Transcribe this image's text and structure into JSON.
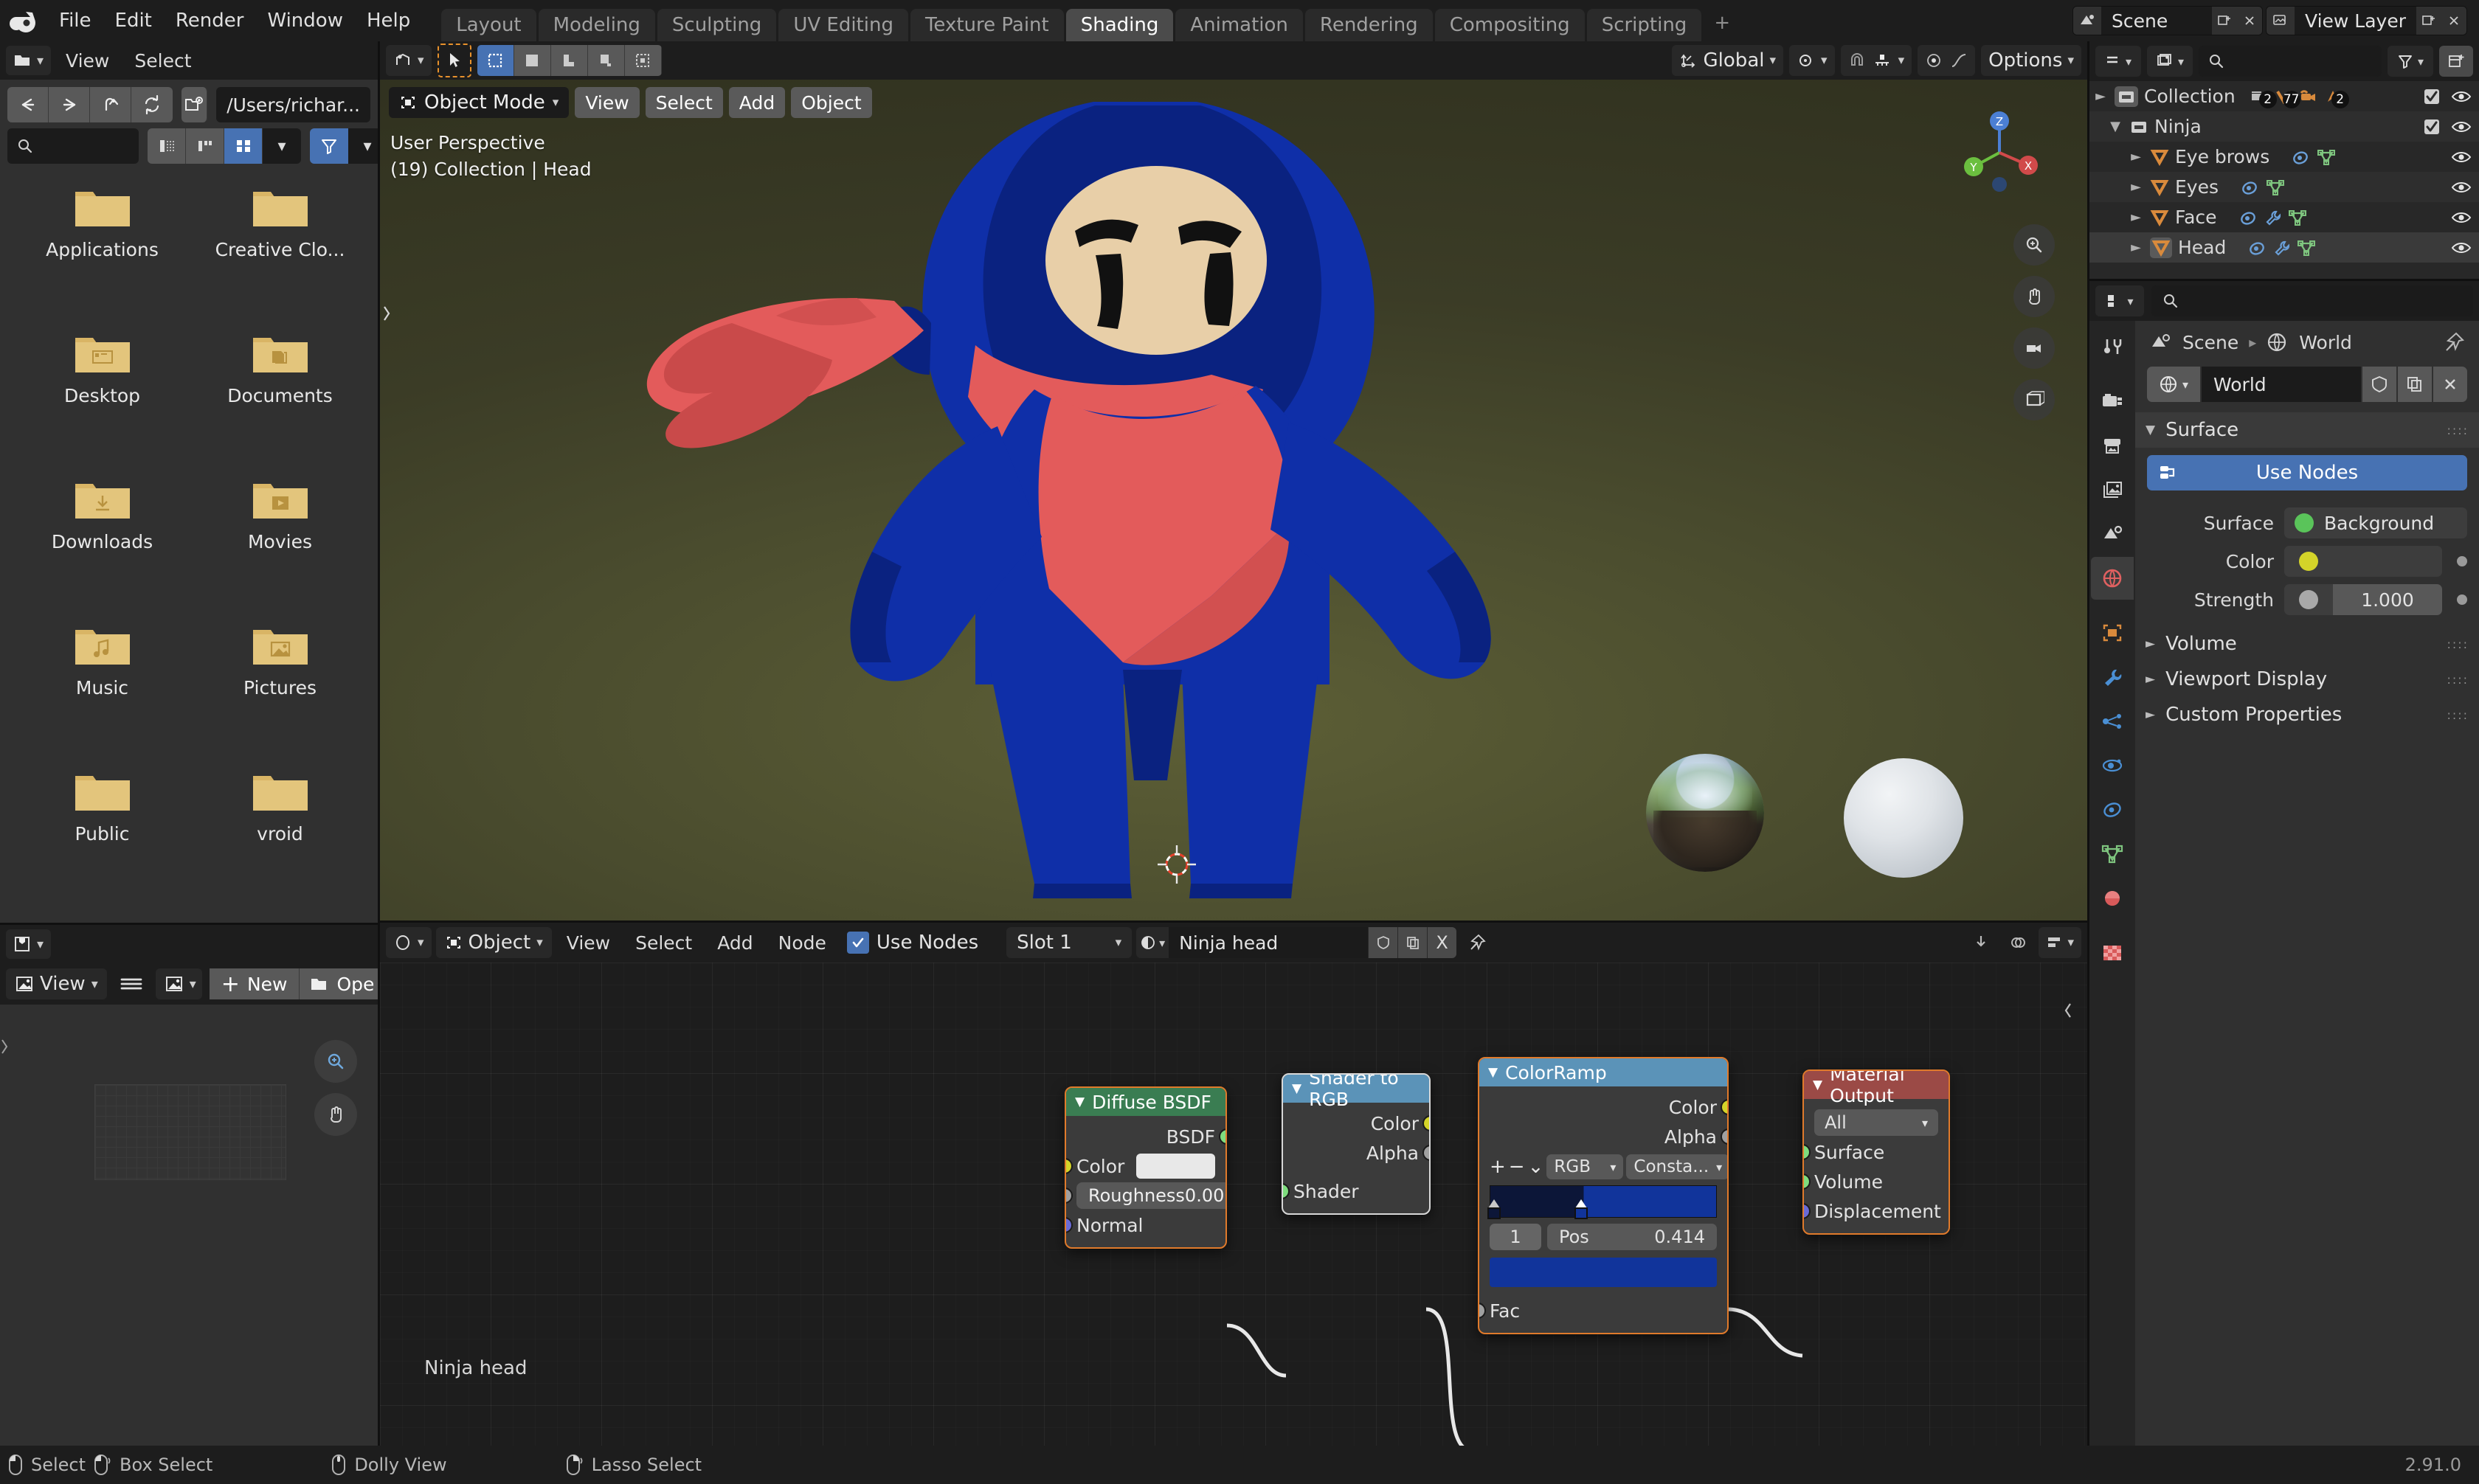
{
  "app": {
    "logo": "blender-logo",
    "version": "2.91.0"
  },
  "topbar": {
    "menus": [
      "File",
      "Edit",
      "Render",
      "Window",
      "Help"
    ],
    "workspaces": [
      {
        "label": "Layout",
        "active": false
      },
      {
        "label": "Modeling",
        "active": false
      },
      {
        "label": "Sculpting",
        "active": false
      },
      {
        "label": "UV Editing",
        "active": false
      },
      {
        "label": "Texture Paint",
        "active": false
      },
      {
        "label": "Shading",
        "active": true
      },
      {
        "label": "Animation",
        "active": false
      },
      {
        "label": "Rendering",
        "active": false
      },
      {
        "label": "Compositing",
        "active": false
      },
      {
        "label": "Scripting",
        "active": false
      }
    ],
    "add_workspace": "+",
    "scene": {
      "icon": "scene-icon",
      "name": "Scene",
      "new_btn": "new-scene-icon",
      "unlink_btn": "x-icon"
    },
    "view_layer": {
      "icon": "view-layer-icon",
      "name": "View Layer",
      "new_btn": "new-layer-icon",
      "unlink_btn": "x-icon"
    }
  },
  "file_browser": {
    "editor_type": "file-browser-icon",
    "menus": [
      "View",
      "Select"
    ],
    "nav": {
      "back": "arrow-left-icon",
      "forward": "arrow-right-icon",
      "up": "arrow-up-icon",
      "refresh": "refresh-icon",
      "new_folder": "new-folder-icon",
      "path": "/Users/richar..."
    },
    "search_placeholder": "",
    "display_modes": [
      "vertical-list-icon",
      "horizontal-list-icon",
      "thumbnail-grid-icon"
    ],
    "display_active_index": 2,
    "filter_icon": "filter-icon",
    "folders": [
      {
        "name": "Applications",
        "glyph": "plain"
      },
      {
        "name": "Creative Clo...",
        "glyph": "plain"
      },
      {
        "name": "Desktop",
        "glyph": "desktop"
      },
      {
        "name": "Documents",
        "glyph": "documents"
      },
      {
        "name": "Downloads",
        "glyph": "download"
      },
      {
        "name": "Movies",
        "glyph": "movie"
      },
      {
        "name": "Music",
        "glyph": "music"
      },
      {
        "name": "Pictures",
        "glyph": "picture"
      },
      {
        "name": "Public",
        "glyph": "plain"
      },
      {
        "name": "vroid",
        "glyph": "plain"
      }
    ]
  },
  "image_editor": {
    "editor_type": "image-editor-icon",
    "view_menu": "View",
    "menu_icon": "hamburger-icon",
    "image_icon": "image-icon",
    "new_label": "New",
    "open_label": "Ope",
    "tools": [
      "zoom-icon",
      "pan-icon"
    ]
  },
  "viewport": {
    "header": {
      "editor_type": "3d-viewport-icon",
      "cursor_tool": "cursor-tool-icon",
      "select_modes": [
        "select-box-icon",
        "select-circle-icon",
        "select-lasso-icon",
        "select-tweak-icon",
        "select-extend-icon"
      ],
      "select_active_index": 0,
      "transform_orientation": "Global",
      "pivot_icon": "pivot-point-icon",
      "snap_icon": "magnet-icon",
      "snap_to": "snap-increment-icon",
      "proportional_icon": "proportional-editing-icon",
      "falloff_icon": "falloff-curve-icon",
      "options_label": "Options",
      "visibility_icon": "visibility-icon",
      "gizmo_icon": "gizmo-icon",
      "overlays_icon": "overlays-icon",
      "xray_icon": "xray-icon",
      "shading_modes": [
        "wireframe-icon",
        "solid-icon",
        "material-preview-icon",
        "rendered-icon"
      ],
      "shading_active_index": 2
    },
    "mode": "Object Mode",
    "menus": [
      "View",
      "Select",
      "Add",
      "Object"
    ],
    "info_line1": "User Perspective",
    "info_line2": "(19) Collection | Head",
    "gizmo_axes": [
      "X",
      "Y",
      "Z"
    ],
    "side_buttons": [
      "zoom-viewport-icon",
      "pan-viewport-icon",
      "camera-view-icon",
      "toggle-ortho-icon"
    ],
    "cursor": "3d-cursor-icon"
  },
  "shader_editor": {
    "editor_type": "shader-editor-icon",
    "shader_type": "Object",
    "menus": [
      "View",
      "Select",
      "Add",
      "Node"
    ],
    "use_nodes_label": "Use Nodes",
    "use_nodes_checked": true,
    "slot": "Slot 1",
    "material": "Ninja head",
    "material_icon": "material-icon",
    "fake_user_icon": "shield-icon",
    "copy_icon": "copy-icon",
    "unlink_label": "X",
    "pin_icon": "pin-icon",
    "snap_icon": "snap-node-icon",
    "overlay_icon": "node-overlay-icon",
    "breadcrumb_label": "Ninja head",
    "nodes": [
      {
        "id": "diffuse-bsdf",
        "title": "Diffuse BSDF",
        "header_color": "#3a7d52",
        "selected": true,
        "outputs": [
          {
            "name": "BSDF",
            "color": "#7edc7e"
          }
        ],
        "inputs": [
          {
            "name": "Color",
            "color": "#d4d429",
            "value": ""
          },
          {
            "name": "Roughness",
            "color": "#a0a0a0",
            "value": "0.000"
          },
          {
            "name": "Normal",
            "color": "#6a6ad6",
            "value": ""
          }
        ]
      },
      {
        "id": "shader-to-rgb",
        "title": "Shader to RGB",
        "header_color": "#5b93b8",
        "selected": false,
        "outputs": [
          {
            "name": "Color",
            "color": "#d4d429"
          },
          {
            "name": "Alpha",
            "color": "#a0a0a0"
          }
        ],
        "inputs": [
          {
            "name": "Shader",
            "color": "#7edc7e"
          }
        ]
      },
      {
        "id": "color-ramp",
        "title": "ColorRamp",
        "header_color": "#5b93b8",
        "selected": true,
        "outputs": [
          {
            "name": "Color",
            "color": "#d4d429"
          },
          {
            "name": "Alpha",
            "color": "#a0a0a0"
          }
        ],
        "inputs": [
          {
            "name": "Fac",
            "color": "#a0a0a0"
          }
        ],
        "controls": {
          "add": "+",
          "remove": "−",
          "menu": "⌄",
          "interpolation_color_mode": "RGB",
          "interpolation": "Consta...",
          "stop_index": "1",
          "pos_label": "Pos",
          "pos_value": "0.414",
          "ramp_left_color": "#0c1638",
          "ramp_right_color": "#11349b",
          "active_color": "#11349b",
          "ramp_split": 41.4
        }
      },
      {
        "id": "material-output",
        "title": "Material Output",
        "header_color": "#9b4a46",
        "selected": true,
        "target": "All",
        "inputs": [
          {
            "name": "Surface",
            "color": "#7edc7e"
          },
          {
            "name": "Volume",
            "color": "#7edc7e"
          },
          {
            "name": "Displacement",
            "color": "#6a6ad6"
          }
        ]
      }
    ]
  },
  "outliner": {
    "display_mode_icon": "outliner-display-icon",
    "filter_id_icon": "id-type-icon",
    "search_placeholder": "",
    "filter_icon": "filter-icon",
    "new_collection_icon": "new-collection-icon",
    "rows": [
      {
        "indent": 0,
        "name": "Collection",
        "icon": "collection-icon",
        "expanded": false,
        "badges": [
          {
            "icon": "mesh-data-icon",
            "count": "2"
          },
          {
            "icon": "vertex-icon",
            "count": "77"
          },
          {
            "icon": "camera-icon",
            "count": ""
          },
          {
            "icon": "armature-icon",
            "count": "2"
          }
        ],
        "checkbox": true,
        "eye": true,
        "selected": false
      },
      {
        "indent": 1,
        "name": "Ninja",
        "icon": "collection-icon",
        "expanded": true,
        "badges": [],
        "checkbox": true,
        "eye": true,
        "selected": false
      },
      {
        "indent": 2,
        "name": "Eye brows",
        "icon": "mesh-object-icon",
        "expanded": false,
        "badges": [
          {
            "icon": "object-data-icon",
            "count": ""
          },
          {
            "icon": "mesh-triangle-icon",
            "count": ""
          }
        ],
        "checkbox": false,
        "eye": true,
        "selected": false
      },
      {
        "indent": 2,
        "name": "Eyes",
        "icon": "mesh-object-icon",
        "expanded": false,
        "badges": [
          {
            "icon": "object-data-icon",
            "count": ""
          },
          {
            "icon": "mesh-triangle-icon",
            "count": ""
          }
        ],
        "checkbox": false,
        "eye": true,
        "selected": false
      },
      {
        "indent": 2,
        "name": "Face",
        "icon": "mesh-object-icon",
        "expanded": false,
        "badges": [
          {
            "icon": "object-data-icon",
            "count": ""
          },
          {
            "icon": "modifier-icon",
            "count": ""
          },
          {
            "icon": "mesh-triangle-icon",
            "count": ""
          }
        ],
        "checkbox": false,
        "eye": true,
        "selected": false
      },
      {
        "indent": 2,
        "name": "Head",
        "icon": "mesh-object-icon",
        "expanded": false,
        "badges": [
          {
            "icon": "object-data-icon",
            "count": ""
          },
          {
            "icon": "modifier-icon",
            "count": ""
          },
          {
            "icon": "mesh-triangle-icon",
            "count": ""
          }
        ],
        "checkbox": false,
        "eye": true,
        "selected": true
      }
    ]
  },
  "properties": {
    "editor_type": "properties-icon",
    "search_placeholder": "",
    "tabs": [
      {
        "name": "tool-tab",
        "icon": "tool-icon",
        "active": false
      },
      {
        "name": "render-tab",
        "icon": "render-camera-icon",
        "active": false
      },
      {
        "name": "output-tab",
        "icon": "printer-icon",
        "active": false
      },
      {
        "name": "view-layer-tab",
        "icon": "images-icon",
        "active": false
      },
      {
        "name": "scene-tab",
        "icon": "scene-cone-icon",
        "active": false
      },
      {
        "name": "world-tab",
        "icon": "world-globe-icon",
        "active": true
      },
      {
        "name": "object-tab",
        "icon": "object-square-icon",
        "active": false
      },
      {
        "name": "modifier-tab",
        "icon": "wrench-icon",
        "active": false
      },
      {
        "name": "particles-tab",
        "icon": "particles-icon",
        "active": false
      },
      {
        "name": "physics-tab",
        "icon": "physics-orbit-icon",
        "active": false
      },
      {
        "name": "constraints-tab",
        "icon": "constraint-icon",
        "active": false
      },
      {
        "name": "data-tab",
        "icon": "mesh-data-triangle-icon",
        "active": false
      },
      {
        "name": "material-tab",
        "icon": "material-sphere-icon",
        "active": false
      },
      {
        "name": "texture-tab",
        "icon": "checker-texture-icon",
        "active": false
      }
    ],
    "breadcrumb": {
      "scene": "Scene",
      "separator": "▸",
      "world": "World",
      "pin_icon": "pin-icon"
    },
    "datablock": {
      "icon": "world-globe-icon",
      "name": "World",
      "fake_user_icon": "shield-icon",
      "copy_icon": "copy-icon",
      "unlink_icon": "x-icon"
    },
    "panels": [
      {
        "name": "Surface",
        "expanded": true
      },
      {
        "name": "Volume",
        "expanded": false
      },
      {
        "name": "Viewport Display",
        "expanded": false
      },
      {
        "name": "Custom Properties",
        "expanded": false
      }
    ],
    "use_nodes_label": "Use Nodes",
    "surface_label": "Surface",
    "surface_value": "Background",
    "surface_dot_color": "#5ac45a",
    "color_label": "Color",
    "color_dot_color": "#d4d429",
    "strength_label": "Strength",
    "strength_value": "1.000",
    "strength_dot_color": "#a8a8a8"
  },
  "statusbar": {
    "items": [
      {
        "icon": "mouse-left-icon",
        "label": "Select"
      },
      {
        "icon": "mouse-left-drag-icon",
        "label": "Box Select"
      },
      {
        "icon": "mouse-middle-icon",
        "label": "Dolly View"
      },
      {
        "icon": "mouse-right-icon",
        "label": "Lasso Select"
      }
    ],
    "version": "2.91.0"
  }
}
